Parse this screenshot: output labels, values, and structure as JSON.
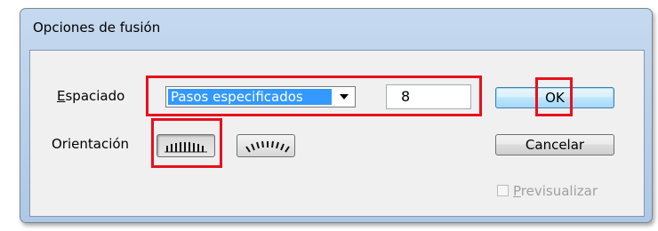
{
  "dialog": {
    "title": "Opciones de fusión"
  },
  "spacing": {
    "label_first": "E",
    "label_rest": "spaciado",
    "mode_value": "Pasos especificados",
    "steps_value": "8"
  },
  "orientation": {
    "label": "Orientación"
  },
  "buttons": {
    "ok": "OK",
    "cancel": "Cancelar"
  },
  "preview": {
    "label_first": "P",
    "label_rest": "revisualizar",
    "checked": false,
    "enabled": false
  },
  "colors": {
    "highlight": "#e8101c",
    "selection": "#3399ff"
  }
}
